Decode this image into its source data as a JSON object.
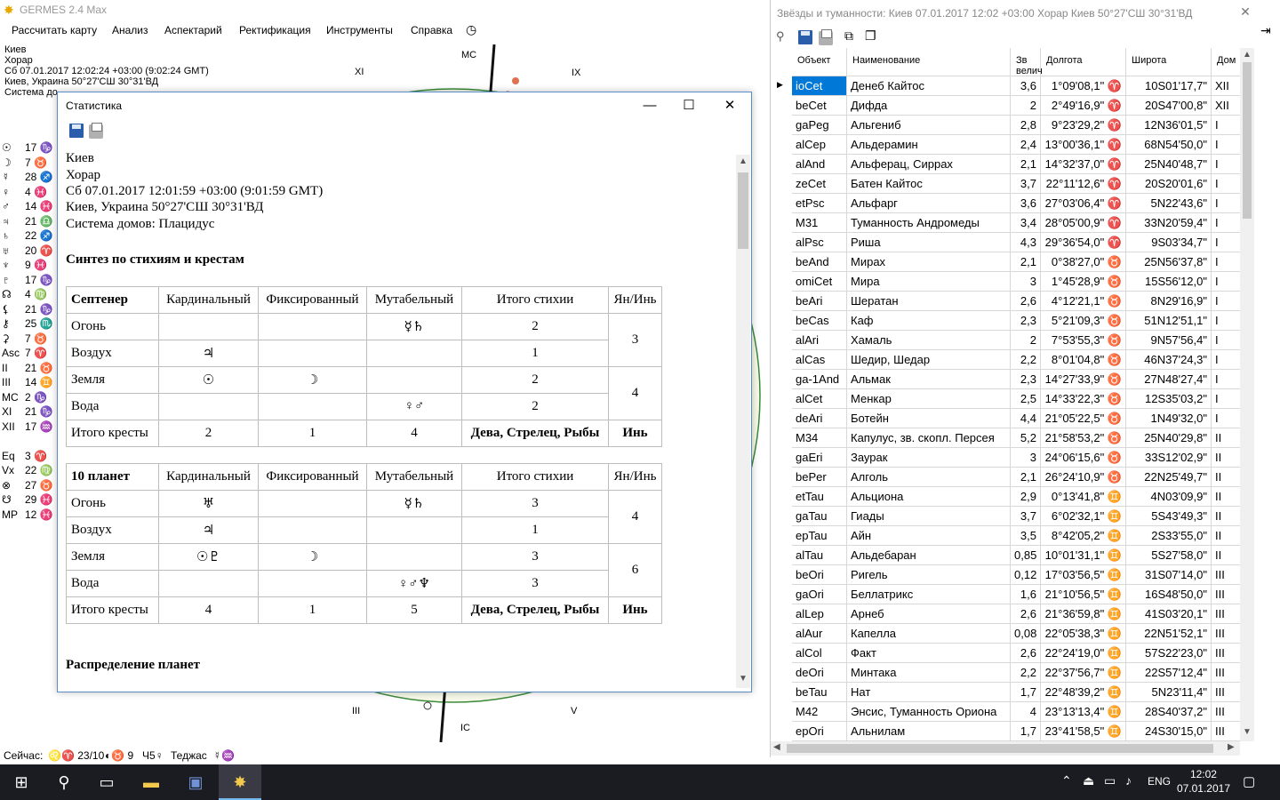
{
  "app": {
    "title": "GERMES 2.4 Max",
    "menu": [
      "Рассчитать карту",
      "Анализ",
      "Аспектарий",
      "Ректификация",
      "Инструменты",
      "Справка"
    ],
    "info": [
      "Киев",
      "Хорар",
      "Сб 07.01.2017 12:02:24 +03:00 (9:02:24 GMT)",
      "Киев, Украина 50°27'СШ 30°31'ВД",
      "Система до"
    ],
    "planets": [
      {
        "sym": "☉",
        "val": "17 ♑"
      },
      {
        "sym": "☽",
        "val": "7 ♉"
      },
      {
        "sym": "☿",
        "val": "28 ♐"
      },
      {
        "sym": "♀",
        "val": "4 ♓"
      },
      {
        "sym": "♂",
        "val": "14 ♓"
      },
      {
        "sym": "♃",
        "val": "21 ♎"
      },
      {
        "sym": "♄",
        "val": "22 ♐"
      },
      {
        "sym": "♅",
        "val": "20 ♈"
      },
      {
        "sym": "♆",
        "val": "9 ♓"
      },
      {
        "sym": "♇",
        "val": "17 ♑"
      },
      {
        "sym": "☊",
        "val": "4 ♍"
      },
      {
        "sym": "⚸",
        "val": "21 ♑"
      },
      {
        "sym": "⚷",
        "val": "25 ♏"
      },
      {
        "sym": "⚳",
        "val": "7 ♉"
      },
      {
        "sym": "Asc",
        "val": "7 ♈"
      },
      {
        "sym": "II",
        "val": "21 ♉"
      },
      {
        "sym": "III",
        "val": "14 ♊"
      },
      {
        "sym": "MC",
        "val": "2 ♑"
      },
      {
        "sym": "XI",
        "val": "21 ♑"
      },
      {
        "sym": "XII",
        "val": "17 ♒"
      },
      {
        "sym": "",
        "val": ""
      },
      {
        "sym": "Eq",
        "val": "3 ♈"
      },
      {
        "sym": "Vx",
        "val": "22 ♍"
      },
      {
        "sym": "⊗",
        "val": "27 ♉"
      },
      {
        "sym": "☋",
        "val": "29 ♓"
      },
      {
        "sym": "MP",
        "val": "12 ♓"
      }
    ],
    "house_labels": {
      "mc": "MC",
      "ic": "IC",
      "xi": "XI",
      "ix": "IX",
      "iii": "III",
      "v": "V"
    },
    "status": {
      "now": "Сейчас:",
      "item1": "♌♈ 23/10",
      "item2": "◐♉ 9",
      "item3": "Ч5♀",
      "item4": "Теджас",
      "item5": "☿♒"
    }
  },
  "stats": {
    "title": "Статистика",
    "header": [
      "Киев",
      "Хорар",
      "Сб 07.01.2017 12:01:59 +03:00 (9:01:59 GMT)",
      "Киев, Украина 50°27'СШ 30°31'ВД",
      "Система домов: Плацидус"
    ],
    "section1": "Синтез по стихиям и крестам",
    "section2": "Распределение планет",
    "table1": {
      "head": [
        "Септенер",
        "Кардинальный",
        "Фиксированный",
        "Мутабельный",
        "Итого стихии",
        "Ян/Инь"
      ],
      "rows": [
        [
          "Огонь",
          "",
          "",
          "☿♄",
          "2"
        ],
        [
          "Воздух",
          "♃",
          "",
          "",
          "1"
        ],
        [
          "Земля",
          "☉",
          "☽",
          "",
          "2"
        ],
        [
          "Вода",
          "",
          "",
          "♀♂",
          "2"
        ]
      ],
      "yang": "3",
      "yin": "4",
      "total": [
        "Итого кресты",
        "2",
        "1",
        "4",
        "Дева, Стрелец, Рыбы",
        "Инь"
      ]
    },
    "table2": {
      "head": [
        "10 планет",
        "Кардинальный",
        "Фиксированный",
        "Мутабельный",
        "Итого стихии",
        "Ян/Инь"
      ],
      "rows": [
        [
          "Огонь",
          "♅",
          "",
          "☿♄",
          "3"
        ],
        [
          "Воздух",
          "♃",
          "",
          "",
          "1"
        ],
        [
          "Земля",
          "☉♇",
          "☽",
          "",
          "3"
        ],
        [
          "Вода",
          "",
          "",
          "♀♂♆",
          "3"
        ]
      ],
      "yang": "4",
      "yin": "6",
      "total": [
        "Итого кресты",
        "4",
        "1",
        "5",
        "Дева, Стрелец, Рыбы",
        "Инь"
      ]
    }
  },
  "stars": {
    "title": "Звёзды и туманности: Киев 07.01.2017 12:02 +03:00 Хорар Киев 50°27'СШ 30°31'ВД",
    "columns": [
      "Объект",
      "Наименование",
      "Зв велич",
      "Долгота",
      "Широта",
      "Дом"
    ],
    "rows": [
      [
        "ioCet",
        "Денеб Кайтос",
        "3,6",
        "1°09'08,1\" ♈",
        "10S01'17,7\"",
        "XII"
      ],
      [
        "beCet",
        "Дифда",
        "2",
        "2°49'16,9\" ♈",
        "20S47'00,8\"",
        "XII"
      ],
      [
        "gaPeg",
        "Альгениб",
        "2,8",
        "9°23'29,2\" ♈",
        "12N36'01,5\"",
        "I"
      ],
      [
        "alCep",
        "Альдерамин",
        "2,4",
        "13°00'36,1\" ♈",
        "68N54'50,0\"",
        "I"
      ],
      [
        "alAnd",
        "Альферац, Сиррах",
        "2,1",
        "14°32'37,0\" ♈",
        "25N40'48,7\"",
        "I"
      ],
      [
        "zeCet",
        "Батен Кайтос",
        "3,7",
        "22°11'12,6\" ♈",
        "20S20'01,6\"",
        "I"
      ],
      [
        "etPsc",
        "Альфарг",
        "3,6",
        "27°03'06,4\" ♈",
        "5N22'43,6\"",
        "I"
      ],
      [
        "M31",
        "Туманность Андромеды",
        "3,4",
        "28°05'00,9\" ♈",
        "33N20'59,4\"",
        "I"
      ],
      [
        "alPsc",
        "Риша",
        "4,3",
        "29°36'54,0\" ♈",
        "9S03'34,7\"",
        "I"
      ],
      [
        "beAnd",
        "Мирах",
        "2,1",
        "0°38'27,0\" ♉",
        "25N56'37,8\"",
        "I"
      ],
      [
        "omiCet",
        "Мира",
        "3",
        "1°45'28,9\" ♉",
        "15S56'12,0\"",
        "I"
      ],
      [
        "beAri",
        "Шератан",
        "2,6",
        "4°12'21,1\" ♉",
        "8N29'16,9\"",
        "I"
      ],
      [
        "beCas",
        "Каф",
        "2,3",
        "5°21'09,3\" ♉",
        "51N12'51,1\"",
        "I"
      ],
      [
        "alAri",
        "Хамаль",
        "2",
        "7°53'55,3\" ♉",
        "9N57'56,4\"",
        "I"
      ],
      [
        "alCas",
        "Шедир, Шедар",
        "2,2",
        "8°01'04,8\" ♉",
        "46N37'24,3\"",
        "I"
      ],
      [
        "ga-1And",
        "Альмак",
        "2,3",
        "14°27'33,9\" ♉",
        "27N48'27,4\"",
        "I"
      ],
      [
        "alCet",
        "Менкар",
        "2,5",
        "14°33'22,3\" ♉",
        "12S35'03,2\"",
        "I"
      ],
      [
        "deAri",
        "Ботейн",
        "4,4",
        "21°05'22,5\" ♉",
        "1N49'32,0\"",
        "I"
      ],
      [
        "M34",
        "Капулус, зв. скопл. Персея",
        "5,2",
        "21°58'53,2\" ♉",
        "25N40'29,8\"",
        "II"
      ],
      [
        "gaEri",
        "Заурак",
        "3",
        "24°06'15,6\" ♉",
        "33S12'02,9\"",
        "II"
      ],
      [
        "bePer",
        "Алголь",
        "2,1",
        "26°24'10,9\" ♉",
        "22N25'49,7\"",
        "II"
      ],
      [
        "etTau",
        "Альциона",
        "2,9",
        "0°13'41,8\" ♊",
        "4N03'09,9\"",
        "II"
      ],
      [
        "gaTau",
        "Гиады",
        "3,7",
        "6°02'32,1\" ♊",
        "5S43'49,3\"",
        "II"
      ],
      [
        "epTau",
        "Айн",
        "3,5",
        "8°42'05,2\" ♊",
        "2S33'55,0\"",
        "II"
      ],
      [
        "alTau",
        "Альдебаран",
        "0,85",
        "10°01'31,1\" ♊",
        "5S27'58,0\"",
        "II"
      ],
      [
        "beOri",
        "Ригель",
        "0,12",
        "17°03'56,5\" ♊",
        "31S07'14,0\"",
        "III"
      ],
      [
        "gaOri",
        "Беллатрикс",
        "1,6",
        "21°10'56,5\" ♊",
        "16S48'50,0\"",
        "III"
      ],
      [
        "alLep",
        "Арнеб",
        "2,6",
        "21°36'59,8\" ♊",
        "41S03'20,1\"",
        "III"
      ],
      [
        "alAur",
        "Капелла",
        "0,08",
        "22°05'38,3\" ♊",
        "22N51'52,1\"",
        "III"
      ],
      [
        "alCol",
        "Факт",
        "2,6",
        "22°24'19,0\" ♊",
        "57S22'23,0\"",
        "III"
      ],
      [
        "deOri",
        "Минтака",
        "2,2",
        "22°37'56,7\" ♊",
        "22S57'12,4\"",
        "III"
      ],
      [
        "beTau",
        "Нат",
        "1,7",
        "22°48'39,2\" ♊",
        "5N23'11,4\"",
        "III"
      ],
      [
        "M42",
        "Энсис, Туманность Ориона",
        "4",
        "23°13'13,4\" ♊",
        "28S40'37,2\"",
        "III"
      ],
      [
        "epOri",
        "Альнилам",
        "1,7",
        "23°41'58,5\" ♊",
        "24S30'15,0\"",
        "III"
      ]
    ]
  },
  "taskbar": {
    "lang": "ENG",
    "time": "12:02",
    "date": "07.01.2017"
  }
}
